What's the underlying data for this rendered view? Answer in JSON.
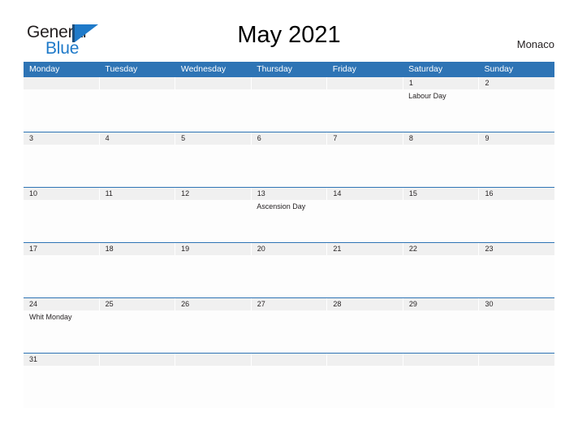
{
  "logo": {
    "word_one": "General",
    "word_two": "Blue",
    "icon": "flag-icon",
    "brand_blue": "#1f7ac9",
    "brand_dark": "#1b4e7d"
  },
  "header": {
    "title": "May 2021",
    "location": "Monaco"
  },
  "calendar": {
    "accent_color": "#2e74b5",
    "date_band_color": "#f0f0f0",
    "weekdays": [
      "Monday",
      "Tuesday",
      "Wednesday",
      "Thursday",
      "Friday",
      "Saturday",
      "Sunday"
    ],
    "weeks": [
      {
        "days": [
          {
            "date": "",
            "event": ""
          },
          {
            "date": "",
            "event": ""
          },
          {
            "date": "",
            "event": ""
          },
          {
            "date": "",
            "event": ""
          },
          {
            "date": "",
            "event": ""
          },
          {
            "date": "1",
            "event": "Labour Day"
          },
          {
            "date": "2",
            "event": ""
          }
        ]
      },
      {
        "days": [
          {
            "date": "3",
            "event": ""
          },
          {
            "date": "4",
            "event": ""
          },
          {
            "date": "5",
            "event": ""
          },
          {
            "date": "6",
            "event": ""
          },
          {
            "date": "7",
            "event": ""
          },
          {
            "date": "8",
            "event": ""
          },
          {
            "date": "9",
            "event": ""
          }
        ]
      },
      {
        "days": [
          {
            "date": "10",
            "event": ""
          },
          {
            "date": "11",
            "event": ""
          },
          {
            "date": "12",
            "event": ""
          },
          {
            "date": "13",
            "event": "Ascension Day"
          },
          {
            "date": "14",
            "event": ""
          },
          {
            "date": "15",
            "event": ""
          },
          {
            "date": "16",
            "event": ""
          }
        ]
      },
      {
        "days": [
          {
            "date": "17",
            "event": ""
          },
          {
            "date": "18",
            "event": ""
          },
          {
            "date": "19",
            "event": ""
          },
          {
            "date": "20",
            "event": ""
          },
          {
            "date": "21",
            "event": ""
          },
          {
            "date": "22",
            "event": ""
          },
          {
            "date": "23",
            "event": ""
          }
        ]
      },
      {
        "days": [
          {
            "date": "24",
            "event": "Whit Monday"
          },
          {
            "date": "25",
            "event": ""
          },
          {
            "date": "26",
            "event": ""
          },
          {
            "date": "27",
            "event": ""
          },
          {
            "date": "28",
            "event": ""
          },
          {
            "date": "29",
            "event": ""
          },
          {
            "date": "30",
            "event": ""
          }
        ]
      },
      {
        "days": [
          {
            "date": "31",
            "event": ""
          },
          {
            "date": "",
            "event": ""
          },
          {
            "date": "",
            "event": ""
          },
          {
            "date": "",
            "event": ""
          },
          {
            "date": "",
            "event": ""
          },
          {
            "date": "",
            "event": ""
          },
          {
            "date": "",
            "event": ""
          }
        ]
      }
    ]
  }
}
